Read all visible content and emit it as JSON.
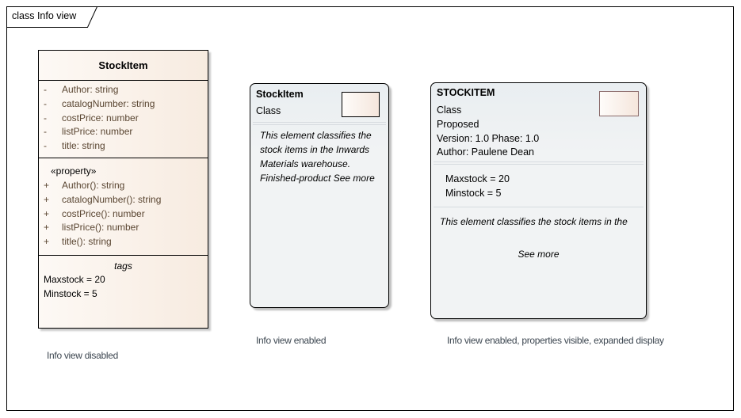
{
  "diagram": {
    "frame_label": "class Info view"
  },
  "class_box": {
    "name": "StockItem",
    "attributes": [
      {
        "visibility": "-",
        "text": "Author: string"
      },
      {
        "visibility": "-",
        "text": "catalogNumber: string"
      },
      {
        "visibility": "-",
        "text": "costPrice: number"
      },
      {
        "visibility": "-",
        "text": "listPrice: number"
      },
      {
        "visibility": "-",
        "text": "title: string"
      }
    ],
    "operations_stereotype": "«property»",
    "operations": [
      {
        "visibility": "+",
        "text": "Author(): string"
      },
      {
        "visibility": "+",
        "text": "catalogNumber(): string"
      },
      {
        "visibility": "+",
        "text": "costPrice(): number"
      },
      {
        "visibility": "+",
        "text": "listPrice(): number"
      },
      {
        "visibility": "+",
        "text": "title(): string"
      }
    ],
    "tags_title": "tags",
    "tags": [
      "Maxstock = 20",
      "Minstock = 5"
    ],
    "caption": "Info view disabled"
  },
  "info_card": {
    "name": "StockItem",
    "type": "Class",
    "description_lines": [
      "This element classifies the",
      "stock items in the Inwards",
      "Materials warehouse.",
      "Finished-product See more"
    ],
    "caption": "Info view enabled"
  },
  "info_card_expanded": {
    "name": "STOCKITEM",
    "type": "Class",
    "status": "Proposed",
    "version": "Version: 1.0 Phase: 1.0",
    "author": "Author: Paulene Dean",
    "tags": [
      "Maxstock = 20",
      "Minstock = 5"
    ],
    "description": "This element classifies the stock items in the",
    "see_more": "See more",
    "caption": "Info view enabled, properties visible, expanded display"
  }
}
